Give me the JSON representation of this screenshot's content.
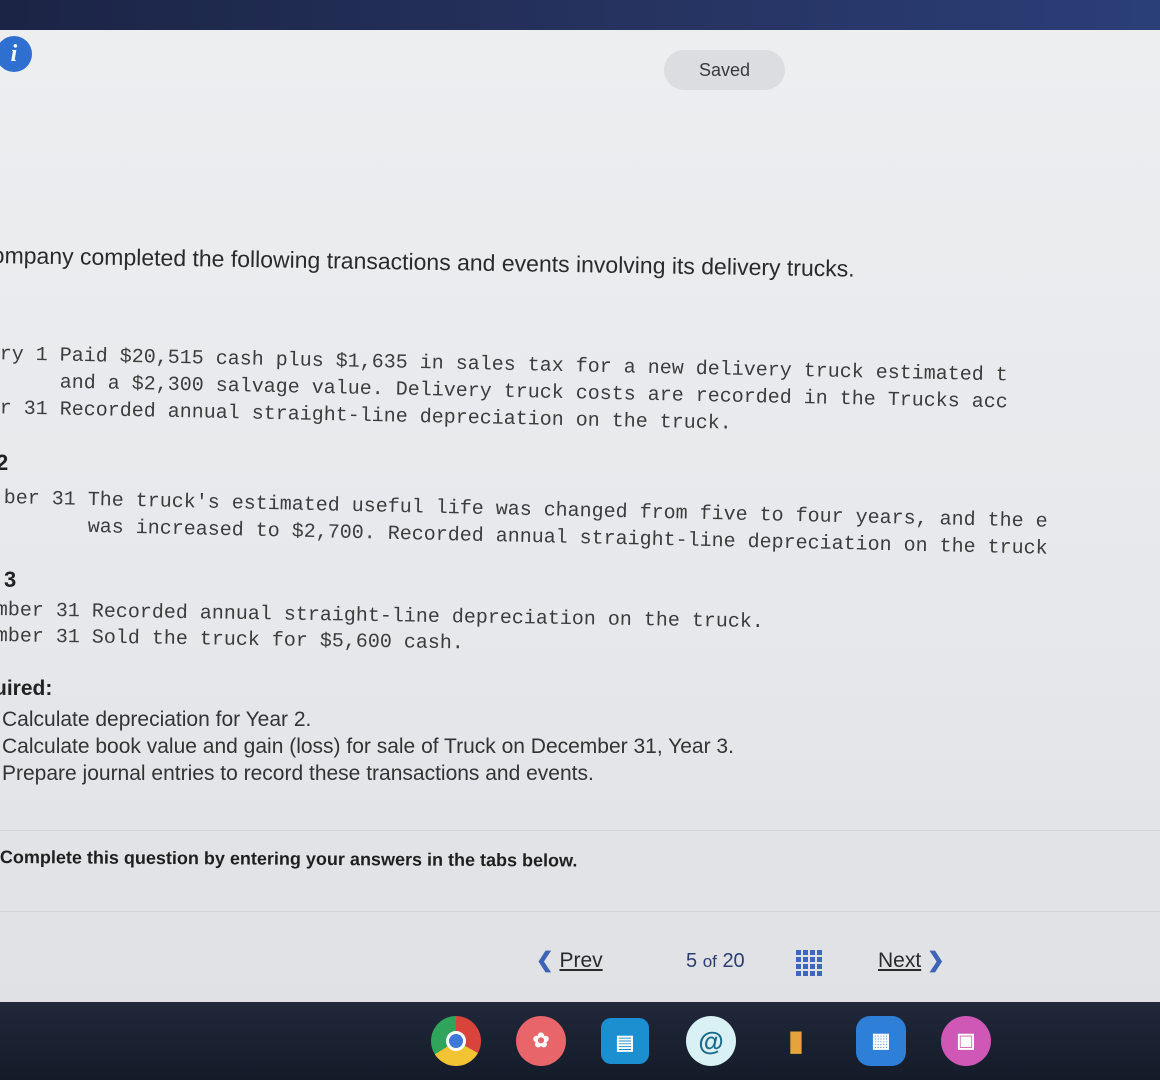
{
  "status": {
    "saved_label": "Saved"
  },
  "problem": {
    "intro": "ompany completed the following transactions and events involving its delivery trucks.",
    "year1_lines": [
      "ary 1 Paid $20,515 cash plus $1,635 in sales tax for a new delivery truck estimated t",
      "      and a $2,300 salvage value. Delivery truck costs are recorded in the Trucks acc",
      "er 31 Recorded annual straight-line depreciation on the truck."
    ],
    "year2_heading": "2",
    "year2_lines": [
      "ber 31 The truck's estimated useful life was changed from five to four years, and the e",
      "       was increased to $2,700. Recorded annual straight-line depreciation on the truck"
    ],
    "year3_heading": "3",
    "year3_lines": [
      "mber 31 Recorded annual straight-line depreciation on the truck.",
      "mber 31 Sold the truck for $5,600 cash."
    ]
  },
  "required": {
    "title": "uired:",
    "items": [
      "Calculate depreciation for Year 2.",
      "Calculate book value and gain (loss) for sale of Truck on December 31, Year 3.",
      "Prepare journal entries to record these transactions and events."
    ]
  },
  "instruction": "Complete this question by entering your answers in the tabs below.",
  "pager": {
    "prev_label": "Prev",
    "current": "5",
    "of_label": "of",
    "total": "20",
    "next_label": "Next"
  },
  "dock": {
    "icons": [
      "chrome-icon",
      "photos-icon",
      "slides-icon",
      "at-icon",
      "files-icon",
      "folder-icon",
      "gallery-icon"
    ]
  },
  "colors": {
    "accent": "#3d63b7",
    "info": "#2f6fd0",
    "shelf": "#141b29"
  }
}
